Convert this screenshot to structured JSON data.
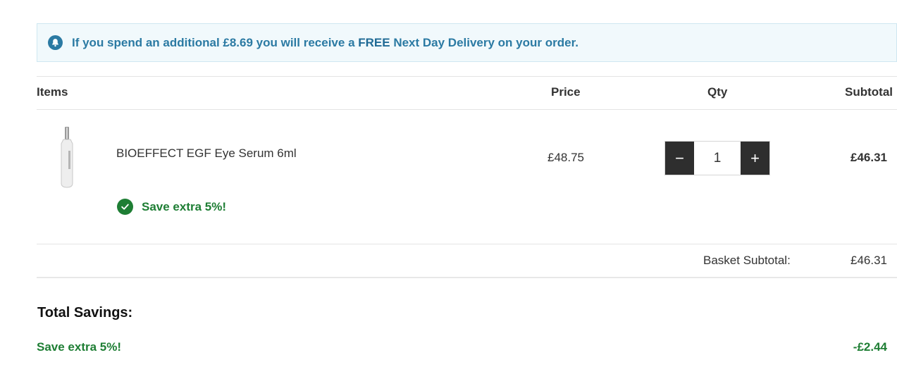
{
  "notice": {
    "icon": "bell-icon",
    "text_before": "If you spend an additional £8.69 you will receive a ",
    "text_strong": "FREE",
    "text_after": " Next Day Delivery on your order.",
    "color": "#2b7aa3"
  },
  "table": {
    "headers": {
      "items": "Items",
      "price": "Price",
      "qty": "Qty",
      "subtotal": "Subtotal"
    }
  },
  "item": {
    "name": "BIOEFFECT EGF Eye Serum 6ml",
    "price": "£48.75",
    "quantity": "1",
    "decrease_symbol": "−",
    "increase_symbol": "+",
    "subtotal": "£46.31",
    "promo": "Save extra 5%!"
  },
  "basket": {
    "label": "Basket Subtotal:",
    "value": "£46.31"
  },
  "savings": {
    "title": "Total Savings:",
    "lines": [
      {
        "label": "Save extra 5%!",
        "value": "-£2.44"
      }
    ],
    "color": "#1e7e34"
  }
}
